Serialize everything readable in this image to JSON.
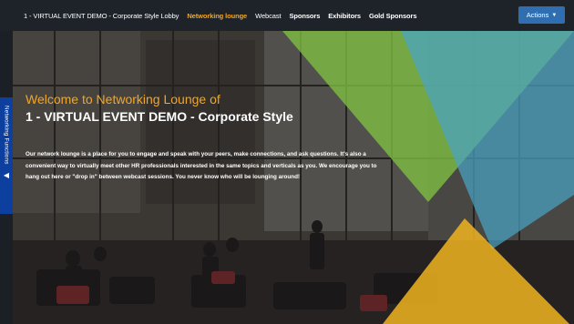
{
  "nav": {
    "items": [
      {
        "label": "1 - VIRTUAL EVENT DEMO - Corporate Style Lobby",
        "active": false
      },
      {
        "label": "Networking lounge",
        "active": true
      },
      {
        "label": "Webcast",
        "active": false
      },
      {
        "label": "Sponsors",
        "active": false
      },
      {
        "label": "Exhibitors",
        "active": false
      },
      {
        "label": "Gold Sponsors",
        "active": false
      }
    ],
    "actions_label": "Actions",
    "actions_icon": "chevron-down-icon"
  },
  "hero": {
    "welcome": "Welcome to Networking Lounge of",
    "event_title": "1 - VIRTUAL EVENT DEMO - Corporate Style",
    "description": "Our network lounge is a place for you to engage and speak with your peers, make connections, and ask questions. It's also a convenient way to virtually meet other HR professionals interested in the same topics and verticals as you. We encourage you to hang out here or \"drop in\" between webcast sessions. You never know who will be lounging around!"
  },
  "side_tab": {
    "label": "Networking Functions",
    "icon": "caret-left-icon"
  },
  "colors": {
    "topbar": "#1e232a",
    "accent_orange": "#f2a623",
    "actions_blue": "#2f6fb1",
    "side_tab_blue": "#0c3f9e",
    "triangle_green": "#7fc241",
    "triangle_teal": "#4aa3c4",
    "triangle_gold": "#f0b420"
  }
}
